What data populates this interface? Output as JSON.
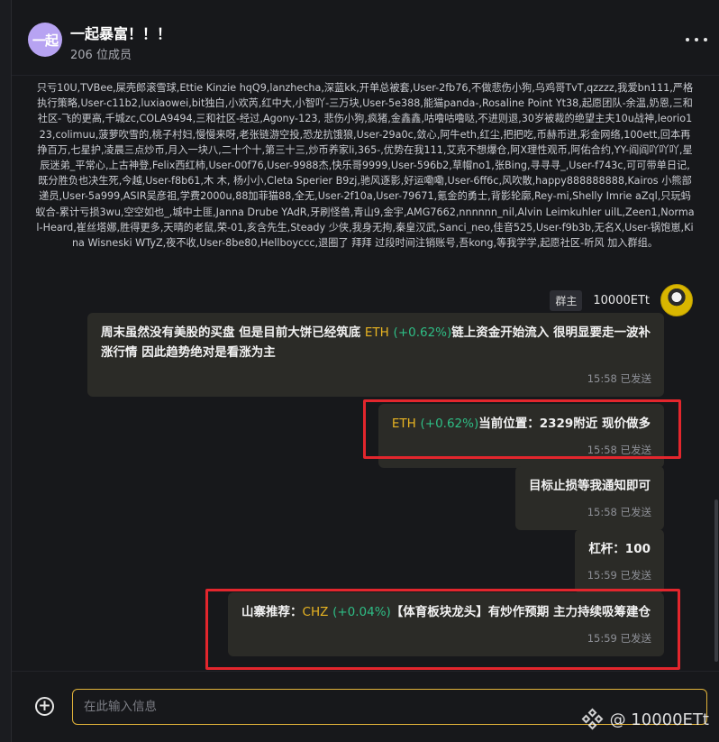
{
  "header": {
    "avatar_text": "一起",
    "title": "一起暴富！！！",
    "members": "206 位成员",
    "more_icon": "more-horizontal-icon"
  },
  "notice": {
    "text": "只亏10U,TVBee,屎壳郎滚雪球,Ettie Kinzie hqQ9,lanzhecha,深蓝kk,开单总被套,User-2fb76,不做悲伤小狗,乌鸡哥TvT,qzzzz,我爱bn111,严格执行策略,User-c11b2,luxiaowei,bit独白,小欢芮,红中大,小智吖-三万块,User-5e388,能猫panda-,Rosaline Point Yt38,起愿团队-余温,奶恩,三和社区-飞的更高,千城zc,COLA9494,三和社区-经过,Agony-123, 悲伤小狗,疯猪,金鑫鑫,咕噜咕噜哒,不进则退,30岁被裁的绝望主夫10u战神,leorio123,colimuu,菠萝吹雪的,桃子村妇,慢慢来呀,老张链游空投,恐龙抗饿狼,User-29a0c,敛心,阿牛eth,红尘,把把吃,币赫币进,彩金网络,100ett,回本再挣百万,七星护,凌晨三点炒币,月入一块八,二十个十,第三十三,炒币养家li,365-,优势在我111,艾克不想爆仓,阿X理性观币,阿佑合约,YY-阎阎吖吖吖,星辰迷弟_平常心,上古神登,Felix西红柿,User-00f76,User-9988杰,快乐哥9999,User-596b2,草帽no1,张Bing,寻寻寻_,User-f743c,可可带单日记,既分胜负也决生死,今越,User-f8b61,木 木, 杨小小,Cleta Sperier B9zj,驰风逐影,好运嘞嘞,User-6ff6c,风吹散,happy888888888,Kairos 小熊部递员,User-5a999,ASIR吴彦祖,学费2000u,88加菲猫88,全无,User-2f10a,User-79671,氪金的勇士,背影轮廓,Rey-mi,Shelly Imrie aZql,只玩蚂蚁合-累计亏损3wu,空空如也_,城中土匪,Janna Drube YAdR,牙刷怪兽,青山9,金宇,AMG7662,nnnnnn_nil,Alvin Leimkuhler uilL,Zeen1,Normal-Heard,崔丝塔娜,胜得更多,天晴的老鼠,荣-01,亥含先生,Steady 少侠,我身无拘,秦皇汉武,Sanci_neo,佳音525,User-f9b3b,无名X,User-锅饱崽,Kina Wisneski WTyZ,夜不收,User-8be80,Hellboyccc,退圈了 拜拜 过段时间注销账号,吾kong,等我学学,起愿社区-听风 加入群组。"
  },
  "sender": {
    "role": "群主",
    "name": "10000ETt"
  },
  "messages": [
    {
      "pre": "周末虽然没有美股的买盘 但是目前大饼已经筑底 ",
      "ticker": "ETH",
      "change": "(+0.62%)",
      "post": "链上资金开始流入 很明显要走一波补涨行情 因此趋势绝对是看涨为主",
      "time": "15:58 已发送"
    },
    {
      "ticker": "ETH",
      "change": "(+0.62%)",
      "post": "当前位置：2329附近 现价做多",
      "time": "15:58 已发送"
    },
    {
      "text": "目标止损等我通知即可",
      "time": "15:58 已发送"
    },
    {
      "text": "杠杆：100",
      "time": "15:59 已发送"
    },
    {
      "pre": "山寨推荐：",
      "ticker": "CHZ",
      "change": "(+0.04%)",
      "post": "【体育板块龙头】有炒作预期 主力持续吸筹建仓",
      "time": "15:59 已发送"
    }
  ],
  "composer": {
    "placeholder": "在此输入信息",
    "add_icon": "plus-circle-icon"
  },
  "watermark": {
    "text": "@ 10000ETt"
  },
  "colors": {
    "ticker": "#e8b422",
    "positive": "#2ebd85",
    "bubble": "#2b2b27",
    "highlight_box": "#e3262d",
    "input_border": "#e0b23a"
  }
}
